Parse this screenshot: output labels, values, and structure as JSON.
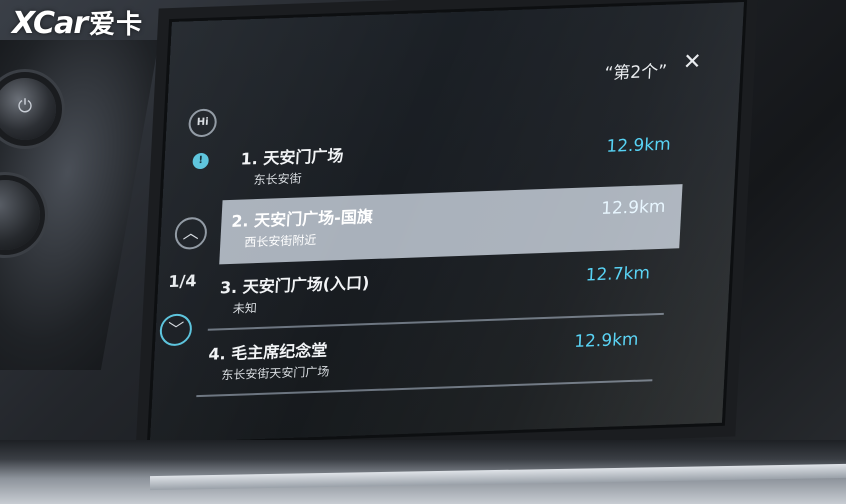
{
  "watermark": {
    "latin": "XCar",
    "chinese": "爱卡"
  },
  "header": {
    "query": "“第2个”",
    "close_glyph": "✕"
  },
  "side": {
    "hi_label": "Hi",
    "up_glyph": "︿",
    "down_glyph": "﹀",
    "page_indicator": "1/4"
  },
  "results": [
    {
      "name": "1. 天安门广场",
      "address": "东长安街",
      "distance": "12.9km",
      "selected": false
    },
    {
      "name": "2. 天安门广场-国旗",
      "address": "西长安街附近",
      "distance": "12.9km",
      "selected": true
    },
    {
      "name": "3. 天安门广场(入口)",
      "address": "未知",
      "distance": "12.7km",
      "selected": false
    },
    {
      "name": "4. 毛主席纪念堂",
      "address": "东长安街天安门广场",
      "distance": "12.9km",
      "selected": false
    }
  ],
  "colors": {
    "accent": "#4fd0f3",
    "selected_row": "#a9b1bb",
    "screen_bg": "#181c21"
  },
  "icons": [
    "power-icon",
    "hi-voice-icon",
    "mic-icon",
    "chevron-up-icon",
    "chevron-down-icon",
    "close-icon"
  ]
}
